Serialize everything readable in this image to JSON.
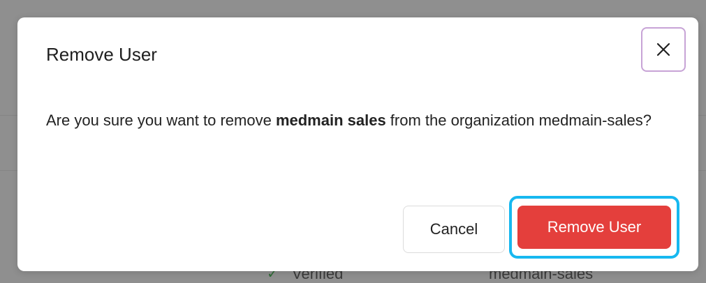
{
  "background": {
    "status_text": "Verified",
    "org_text": "medmain-sales",
    "check_icon": "check-icon"
  },
  "modal": {
    "title": "Remove User",
    "close_icon": "close-icon",
    "message_prefix": "Are you sure you want to remove ",
    "user_name": "medmain sales",
    "message_suffix": " from the organization medmain-sales?",
    "cancel_label": "Cancel",
    "confirm_label": "Remove User"
  },
  "colors": {
    "confirm_button": "#e43f3c",
    "focus_ring": "#17b8f0",
    "close_button_border": "#c7a3d6"
  }
}
